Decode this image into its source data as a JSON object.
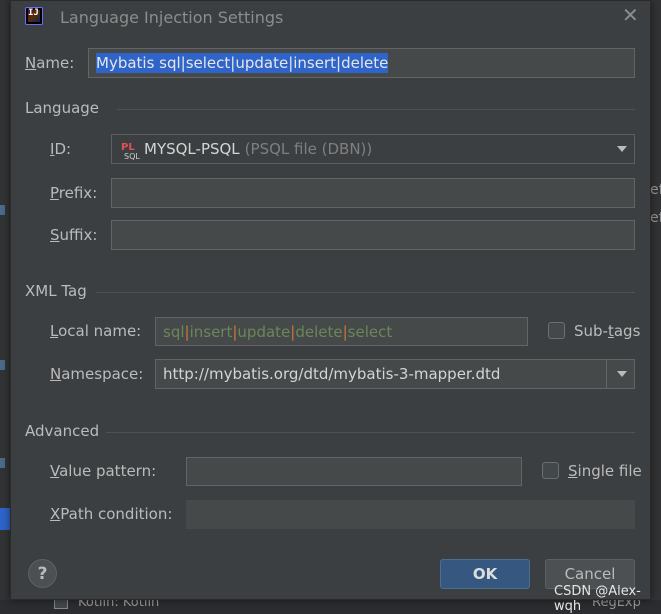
{
  "background": {
    "bottom_item_left": "Kotlin: Kotlin",
    "bottom_item_right": "RegExp",
    "right_fragment": "ef"
  },
  "dialog": {
    "title": "Language Injection Settings",
    "name_label": "Name:",
    "name_value": "Mybatis sql|select|update|insert|delete",
    "language": {
      "section": "Language",
      "id_label": "ID:",
      "id_value": "MYSQL-PSQL",
      "id_hint": "(PSQL file (DBN))",
      "prefix_label": "Prefix:",
      "prefix_value": "",
      "suffix_label": "Suffix:",
      "suffix_value": ""
    },
    "xml_tag": {
      "section": "XML Tag",
      "local_name_label": "Local name:",
      "local_name_parts": [
        "sql",
        "insert",
        "update",
        "delete",
        "select"
      ],
      "sub_tags_label": "Sub-tags",
      "sub_tags_checked": false,
      "namespace_label": "Namespace:",
      "namespace_value": "http://mybatis.org/dtd/mybatis-3-mapper.dtd"
    },
    "advanced": {
      "section": "Advanced",
      "value_pattern_label": "Value pattern:",
      "value_pattern_value": "",
      "single_file_label": "Single file",
      "single_file_checked": false,
      "xpath_label": "XPath condition:",
      "xpath_value": ""
    },
    "buttons": {
      "help": "?",
      "ok": "OK",
      "cancel": "Cancel"
    }
  },
  "watermark": "CSDN @Alex-wqh",
  "colors": {
    "accent": "#365880",
    "selection": "#2f65ca",
    "regex_text": "#6a8759",
    "regex_separator": "#cc7832"
  }
}
